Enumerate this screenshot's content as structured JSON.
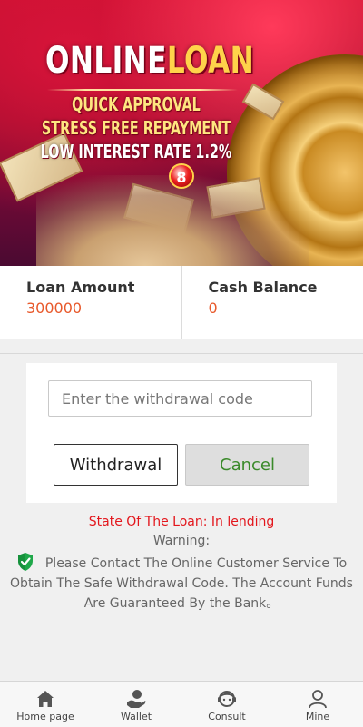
{
  "banner": {
    "title_part1": "ONLINE",
    "title_part2": "LOAN",
    "line1": "QUICK APPROVAL",
    "line2": "STRESS FREE REPAYMENT",
    "line3": "LOW INTEREST RATE 1.2%",
    "coin_label": "8"
  },
  "balances": {
    "loan_amount_label": "Loan Amount",
    "loan_amount_value": "300000",
    "cash_balance_label": "Cash Balance",
    "cash_balance_value": "0"
  },
  "form": {
    "code_placeholder": "Enter the withdrawal code",
    "withdraw_label": "Withdrawal",
    "cancel_label": "Cancel"
  },
  "status": {
    "state_text": "State Of The Loan:   In lending",
    "warning_label": "Warning:",
    "warning_text": "Please Contact The Online Customer Service To Obtain The Safe Withdrawal Code. The Account Funds Are Guaranteed By the Bank。"
  },
  "nav": {
    "items": [
      {
        "label": "Home page",
        "icon": "home-icon"
      },
      {
        "label": "Wallet",
        "icon": "wallet-icon"
      },
      {
        "label": "Consult",
        "icon": "consult-icon"
      },
      {
        "label": "Mine",
        "icon": "user-icon"
      }
    ]
  },
  "colors": {
    "accent_orange": "#e8592b",
    "status_red": "#e3161c",
    "cancel_green": "#3a8a2a"
  }
}
